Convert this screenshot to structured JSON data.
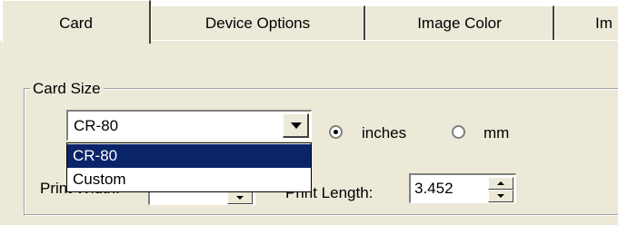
{
  "tabs": [
    {
      "label": "Card",
      "active": true
    },
    {
      "label": "Device Options",
      "active": false
    },
    {
      "label": "Image Color",
      "active": false
    },
    {
      "label": "Im",
      "active": false
    }
  ],
  "card_size": {
    "group_label": "Card Size",
    "combo_value": "CR-80",
    "dropdown_options": [
      "CR-80",
      "Custom"
    ],
    "selected_option": "CR-80",
    "unit_inches_label": "inches",
    "unit_mm_label": "mm",
    "selected_unit": "inches"
  },
  "fields": {
    "print_width_label": "Print Width:",
    "print_length_label": "Print Length:",
    "print_length_value": "3.452"
  },
  "colors": {
    "panel": "#ece9d8",
    "selection": "#0a246a"
  },
  "icons": {
    "dropdown_arrow": "chevron-down-icon",
    "spin_up": "arrow-up-icon",
    "spin_down": "arrow-down-icon"
  }
}
